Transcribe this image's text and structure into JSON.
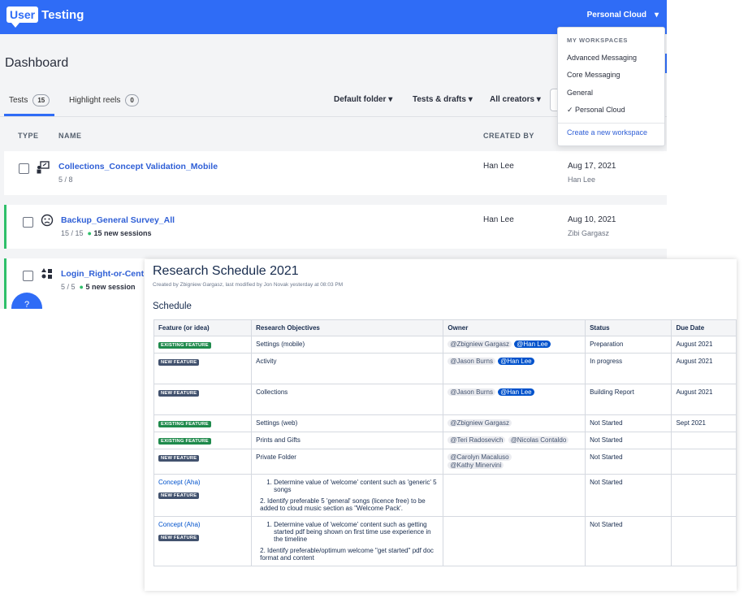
{
  "logo": {
    "box": "User",
    "text": "Testing"
  },
  "workspace_selector": {
    "label": "Personal Cloud",
    "caret": "▾"
  },
  "page_title": "Dashboard",
  "tabs": [
    {
      "label": "Tests",
      "count": "15"
    },
    {
      "label": "Highlight reels",
      "count": "0"
    }
  ],
  "filters": [
    "Default folder ▾",
    "Tests & drafts ▾",
    "All creators ▾"
  ],
  "columns": {
    "type": "TYPE",
    "name": "NAME",
    "created_by": "CREATED BY"
  },
  "tests": [
    {
      "name": "Collections_Concept Validation_Mobile",
      "progress": "5 / 8",
      "sessions": "",
      "creator": "Han Lee",
      "date": "Aug 17, 2021",
      "date_by": "Han Lee",
      "icon": "presentation-icon"
    },
    {
      "name": "Backup_General Survey_All",
      "progress": "15 / 15",
      "sessions": "15 new sessions",
      "creator": "Han Lee",
      "date": "Aug 10, 2021",
      "date_by": "Zibi Gargasz",
      "icon": "sad-face-icon"
    },
    {
      "name": "Login_Right-or-Cent",
      "progress": "5 / 5",
      "sessions": "5 new session",
      "creator": "",
      "date": "",
      "date_by": "",
      "icon": "shapes-icon"
    }
  ],
  "workspace_menu": {
    "heading": "MY WORKSPACES",
    "items": [
      "Advanced Messaging",
      "Core Messaging",
      "General",
      "✓ Personal Cloud"
    ],
    "create": "Create a new workspace"
  },
  "help_badge": "?",
  "confluence": {
    "title": "Research Schedule 2021",
    "meta": "Created by Zbigniew Gargasz, last modified by Jon Novak yesterday at 08:03 PM",
    "section": "Schedule",
    "headers": [
      "Feature (or idea)",
      "Research Objectives",
      "Owner",
      "Status",
      "Due Date"
    ],
    "rows": [
      {
        "link": "",
        "lozenge": "EXISTING FEATURE",
        "objective": "Settings (mobile)",
        "owners": [
          "@Zbigniew Gargasz"
        ],
        "me": "@Han Lee",
        "status": "Preparation",
        "due": "August 2021"
      },
      {
        "link": "",
        "lozenge": "NEW FEATURE",
        "objective": "Activity",
        "owners": [
          "@Jason Burns"
        ],
        "me": "@Han Lee",
        "status": "In progress",
        "due": "August 2021"
      },
      {
        "link": "",
        "lozenge": "NEW FEATURE",
        "objective": "Collections",
        "owners": [
          "@Jason Burns"
        ],
        "me": "@Han Lee",
        "status": "Building Report",
        "due": "August 2021"
      },
      {
        "link": "",
        "lozenge": "EXISTING FEATURE",
        "objective": "Settings (web)",
        "owners": [
          "@Zbigniew Gargasz"
        ],
        "me": "",
        "status": "Not Started",
        "due": "Sept 2021"
      },
      {
        "link": "",
        "lozenge": "EXISTING FEATURE",
        "objective": "Prints and Gifts",
        "owners": [
          "@Teri Radosevich",
          "@Nicolas Contaldo"
        ],
        "me": "",
        "status": "Not Started",
        "due": ""
      },
      {
        "link": "",
        "lozenge": "NEW FEATURE",
        "objective": "Private Folder",
        "owners": [
          "@Carolyn Macaluso",
          "@Kathy Minervini"
        ],
        "me": "",
        "status": "Not Started",
        "due": ""
      }
    ],
    "concept_rows": [
      {
        "link": "Concept (Aha)",
        "lozenge": "NEW FEATURE",
        "items": [
          "Determine value of 'welcome' content such as 'generic' 5 songs"
        ],
        "extra": "2. Identify preferable 5 'general' songs (licence free) to be added to cloud music section as \"Welcome Pack'.",
        "status": "Not Started"
      },
      {
        "link": "Concept (Aha)",
        "lozenge": "NEW FEATURE",
        "items": [
          "Determine value of 'welcome' content such as getting started pdf being shown on first time use experience in the timeline"
        ],
        "extra": "2. Identify preferable/optimum welcome \"get started\" pdf doc format and content",
        "status": "Not Started"
      }
    ]
  }
}
